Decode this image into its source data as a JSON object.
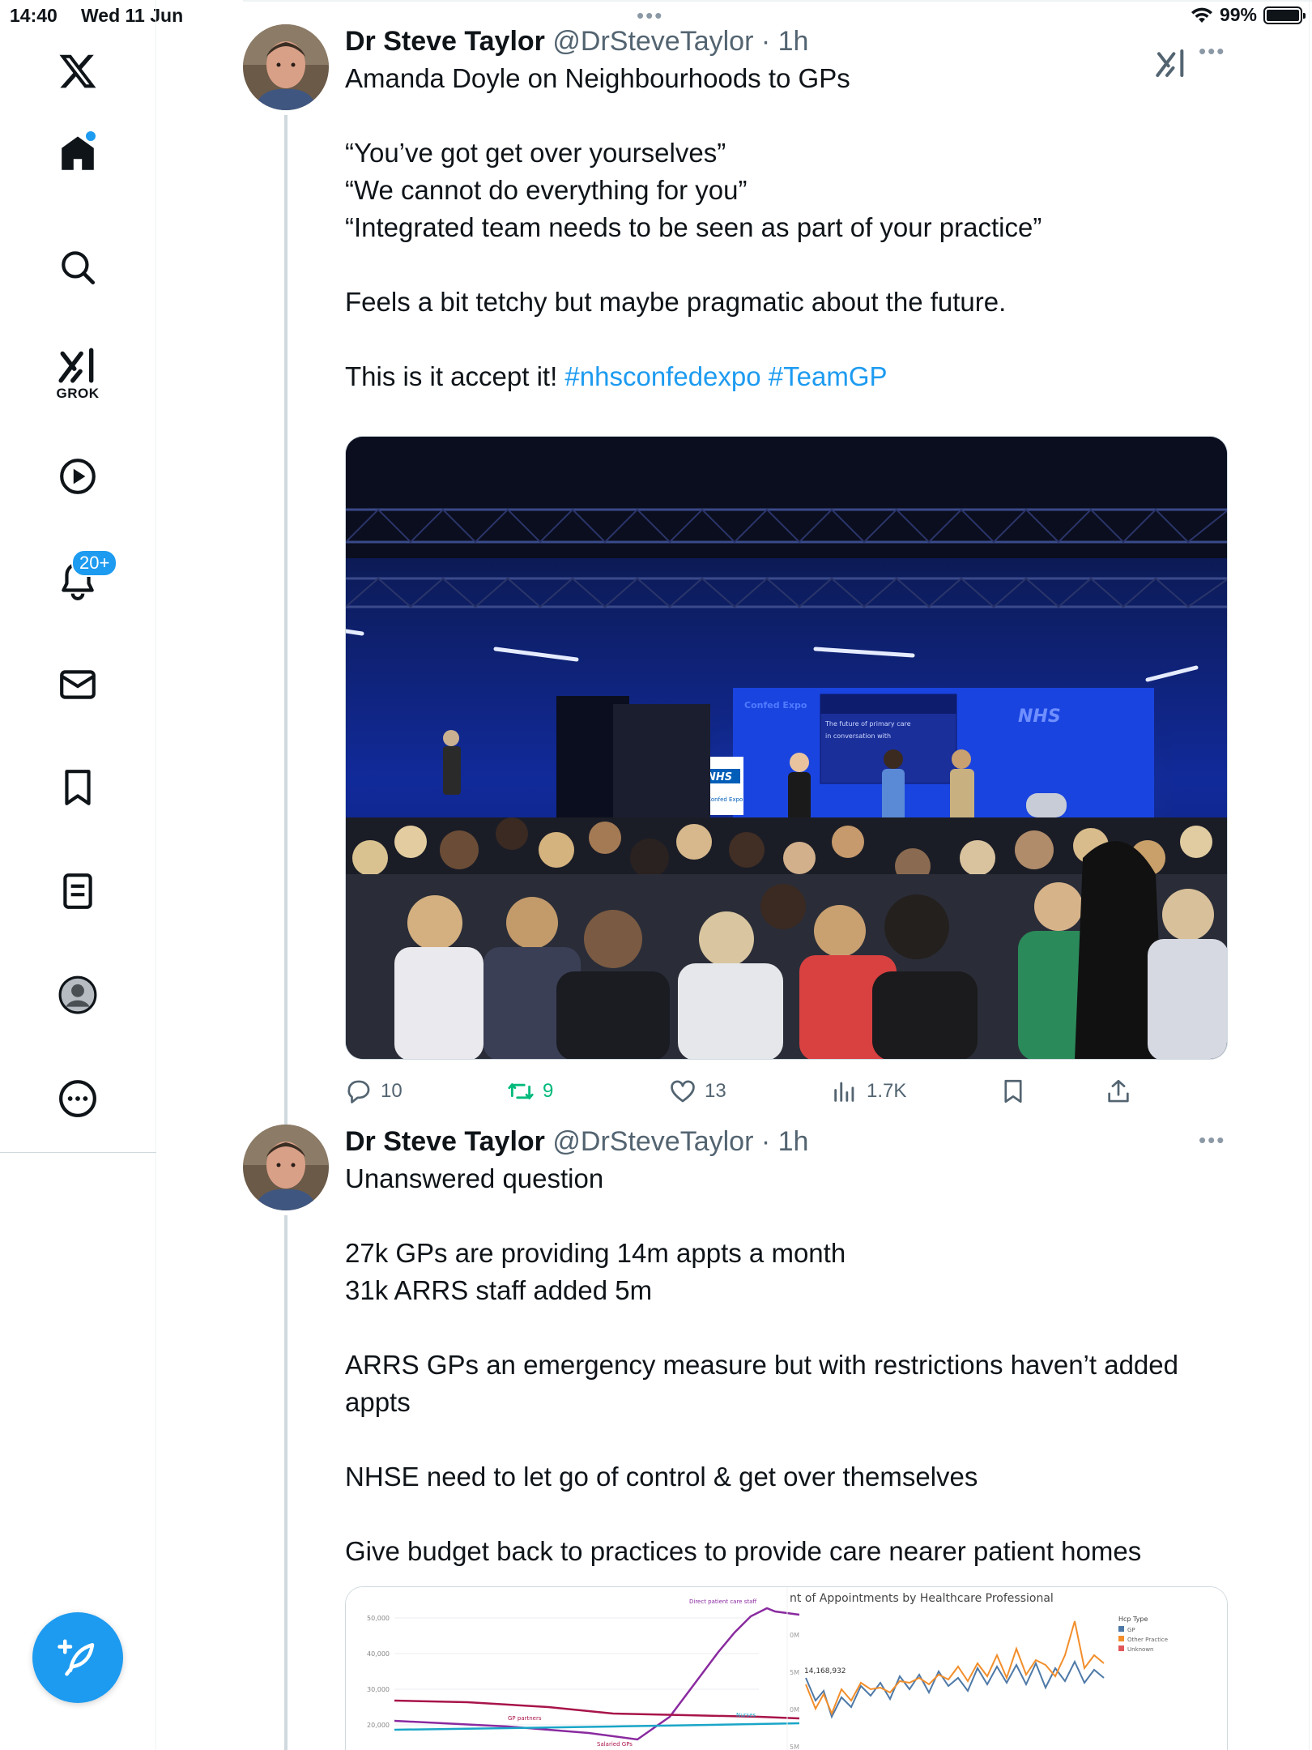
{
  "status_bar": {
    "time": "14:40",
    "date": "Wed 11 Jun",
    "battery": "99%",
    "battery_level": 0.99
  },
  "nav": {
    "items": [
      {
        "name": "logo",
        "icon": "x-logo-icon"
      },
      {
        "name": "home",
        "icon": "home-icon"
      },
      {
        "name": "explore",
        "icon": "search-icon"
      },
      {
        "name": "grok",
        "icon": "grok-icon",
        "label": "GROK"
      },
      {
        "name": "videos",
        "icon": "play-icon"
      },
      {
        "name": "notifications",
        "icon": "bell-icon",
        "badge": "20+"
      },
      {
        "name": "messages",
        "icon": "mail-icon"
      },
      {
        "name": "bookmarks",
        "icon": "bookmark-icon"
      },
      {
        "name": "lists",
        "icon": "list-icon"
      },
      {
        "name": "profile",
        "icon": "user-icon"
      },
      {
        "name": "more",
        "icon": "more-icon"
      }
    ],
    "compose_icon": "compose-icon",
    "accent": "#1d9bf0"
  },
  "tweets": [
    {
      "name": "Dr Steve Taylor",
      "handle": "@DrSteveTaylor",
      "dot": "·",
      "time": "1h",
      "lines": [
        "Amanda Doyle on Neighbourhoods to GPs",
        "“You’ve got get over yourselves”",
        "“We cannot do everything for you”",
        "“Integrated team needs to be seen as part of your practice”",
        "Feels a bit tetchy but maybe pragmatic about the future.",
        "This is it accept it!"
      ],
      "hashtags": [
        "#nhsconfedexpo",
        "#TeamGP"
      ],
      "photo": {
        "signs": [
          "Confed Expo",
          "NHS",
          "NHS",
          "Confed Expo"
        ]
      },
      "stats": {
        "replies": "10",
        "retweets": "9",
        "likes": "13",
        "views": "1.7K"
      }
    },
    {
      "name": "Dr Steve Taylor",
      "handle": "@DrSteveTaylor",
      "dot": "·",
      "time": "1h",
      "lines": [
        "Unanswered question",
        "27k GPs are providing 14m appts a month",
        "31k ARRS staff added 5m",
        "ARRS GPs an emergency measure but with restrictions haven’t added",
        "appts",
        "NHSE need to let go of control & get over themselves",
        "Give budget back to practices to provide care nearer patient homes"
      ],
      "chart_left": {
        "y_ticks": [
          "50,000",
          "40,000",
          "30,000",
          "20,000"
        ],
        "labels": [
          "Direct patient care staff",
          "GP partners",
          "Nurses",
          "Salaried GPs"
        ]
      },
      "chart_right": {
        "title": "nt of Appointments by Healthcare Professional",
        "y_ticks": [
          "0M",
          "5M",
          "0M",
          "5M"
        ],
        "value_label": "14,168,932",
        "legend_title": "Hcp Type",
        "legend": [
          "GP",
          "Other Practice",
          "Unknown"
        ],
        "colors": [
          "#4e79a7",
          "#f28e2b",
          "#e15759"
        ]
      }
    }
  ]
}
